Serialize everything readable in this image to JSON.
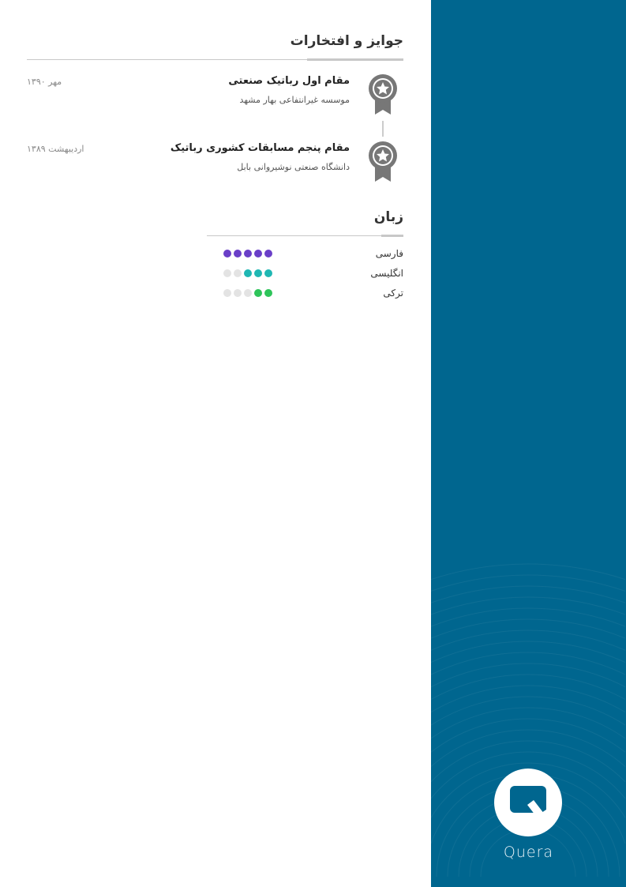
{
  "awards": {
    "title": "جوایز و افتخارات",
    "items": [
      {
        "title": "مقام اول رباتیک صنعتی",
        "org": "موسسه غیرانتفاعی بهار مشهد",
        "date": "مهر ۱۳۹۰"
      },
      {
        "title": "مقام پنجم مسابقات کشوری رباتیک",
        "org": "دانشگاه صنعتی نوشیروانی بابل",
        "date": "اردیبهشت ۱۳۸۹"
      }
    ]
  },
  "languages": {
    "title": "زبان",
    "max_level": 5,
    "items": [
      {
        "name": "فارسی",
        "level": 5,
        "color": "#6a3fc8"
      },
      {
        "name": "انگلیسی",
        "level": 3,
        "color": "#1fb7b3"
      },
      {
        "name": "ترکی",
        "level": 2,
        "color": "#2ec45a"
      }
    ]
  },
  "sidebar": {
    "background": "#00668f",
    "logo_text": "Quera"
  }
}
